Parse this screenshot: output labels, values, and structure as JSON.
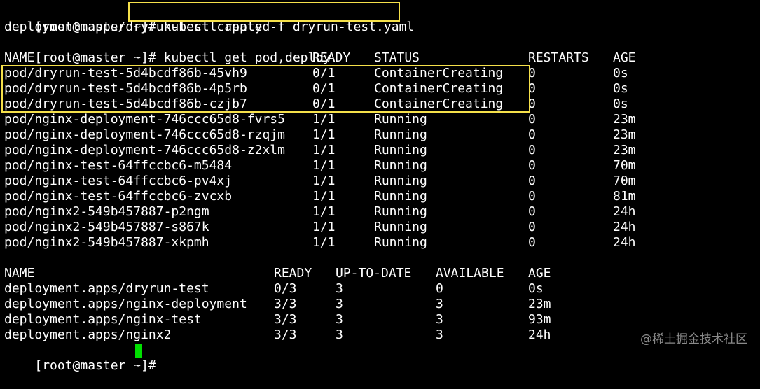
{
  "terminal": {
    "prompt_1": "[root@master ~]# ",
    "command_1": "kubectl apply -f dryrun-test.yaml",
    "output_1": "deployment.apps/dryrun-test created",
    "prompt_2": "[root@master ~]# ",
    "command_2": "kubectl get pod,deploy",
    "pods": {
      "headers": [
        "NAME",
        "READY",
        "STATUS",
        "RESTARTS",
        "AGE"
      ],
      "rows": [
        [
          "pod/dryrun-test-5d4bcdf86b-45vh9",
          "0/1",
          "ContainerCreating",
          "0",
          "0s"
        ],
        [
          "pod/dryrun-test-5d4bcdf86b-4p5rb",
          "0/1",
          "ContainerCreating",
          "0",
          "0s"
        ],
        [
          "pod/dryrun-test-5d4bcdf86b-czjb7",
          "0/1",
          "ContainerCreating",
          "0",
          "0s"
        ],
        [
          "pod/nginx-deployment-746ccc65d8-fvrs5",
          "1/1",
          "Running",
          "0",
          "23m"
        ],
        [
          "pod/nginx-deployment-746ccc65d8-rzqjm",
          "1/1",
          "Running",
          "0",
          "23m"
        ],
        [
          "pod/nginx-deployment-746ccc65d8-z2xlm",
          "1/1",
          "Running",
          "0",
          "23m"
        ],
        [
          "pod/nginx-test-64ffccbc6-m5484",
          "1/1",
          "Running",
          "0",
          "70m"
        ],
        [
          "pod/nginx-test-64ffccbc6-pv4xj",
          "1/1",
          "Running",
          "0",
          "70m"
        ],
        [
          "pod/nginx-test-64ffccbc6-zvcxb",
          "1/1",
          "Running",
          "0",
          "81m"
        ],
        [
          "pod/nginx2-549b457887-p2ngm",
          "1/1",
          "Running",
          "0",
          "24h"
        ],
        [
          "pod/nginx2-549b457887-s867k",
          "1/1",
          "Running",
          "0",
          "24h"
        ],
        [
          "pod/nginx2-549b457887-xkpmh",
          "1/1",
          "Running",
          "0",
          "24h"
        ]
      ]
    },
    "deployments": {
      "headers": [
        "NAME",
        "READY",
        "UP-TO-DATE",
        "AVAILABLE",
        "AGE"
      ],
      "rows": [
        [
          "deployment.apps/dryrun-test",
          "0/3",
          "3",
          "0",
          "0s"
        ],
        [
          "deployment.apps/nginx-deployment",
          "3/3",
          "3",
          "3",
          "23m"
        ],
        [
          "deployment.apps/nginx-test",
          "3/3",
          "3",
          "3",
          "93m"
        ],
        [
          "deployment.apps/nginx2",
          "3/3",
          "3",
          "3",
          "24h"
        ]
      ]
    },
    "prompt_3": "[root@master ~]# "
  },
  "watermark": "@稀土掘金技术社区",
  "colors": {
    "background": "#000000",
    "text": "#ffffff",
    "highlight_box": "#f5e04a",
    "cursor": "#00e000",
    "watermark": "#8a8a8a"
  }
}
